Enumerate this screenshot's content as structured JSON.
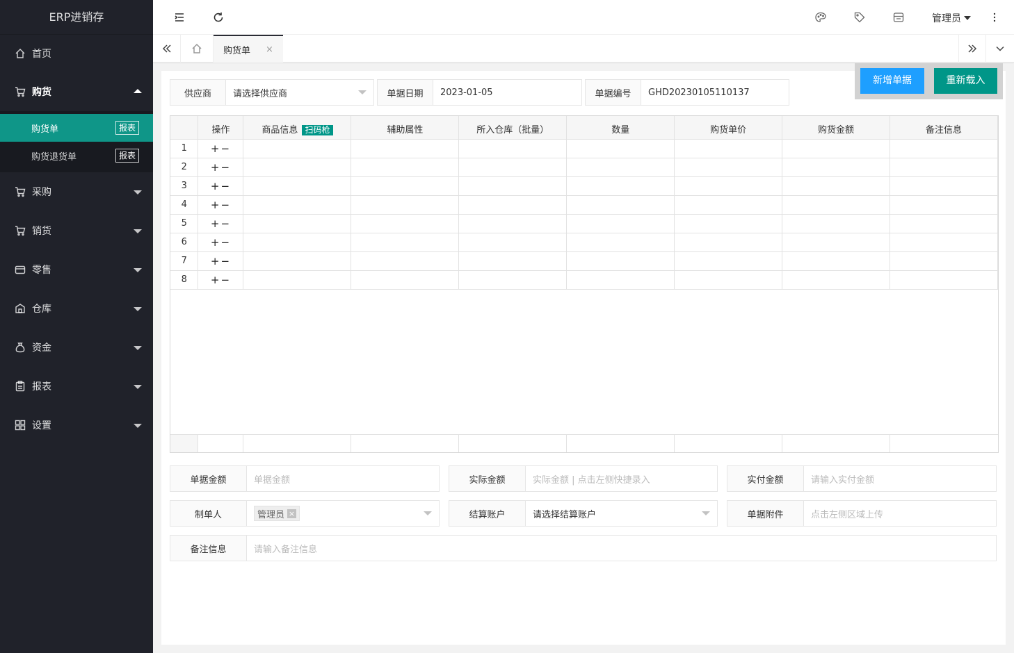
{
  "app": {
    "title": "ERP进销存"
  },
  "sidebar": {
    "home": "首页",
    "purchase_goods": "购货",
    "sub_items": [
      {
        "label": "购货单",
        "tag": "报表"
      },
      {
        "label": "购货退货单",
        "tag": "报表"
      }
    ],
    "procurement": "采购",
    "sales": "销货",
    "retail": "零售",
    "warehouse": "仓库",
    "funds": "资金",
    "reports": "报表",
    "settings": "设置"
  },
  "header": {
    "user": "管理员"
  },
  "tabs": {
    "active": "购货单",
    "close": "×"
  },
  "actions": {
    "new": "新增单据",
    "reload": "重新载入"
  },
  "form": {
    "supplier_label": "供应商",
    "supplier_placeholder": "请选择供应商",
    "date_label": "单据日期",
    "date_value": "2023-01-05",
    "number_label": "单据编号",
    "number_value": "GHD20230105110137"
  },
  "grid": {
    "headers": [
      "操作",
      "商品信息",
      "辅助属性",
      "所入仓库（批量）",
      "数量",
      "购货单价",
      "购货金额",
      "备注信息"
    ],
    "scan_tag": "扫码枪",
    "rows": [
      "1",
      "2",
      "3",
      "4",
      "5",
      "6",
      "7",
      "8"
    ],
    "ops": "+−"
  },
  "bottom": {
    "amount_label": "单据金额",
    "amount_placeholder": "单据金额",
    "actual_label": "实际金额",
    "actual_placeholder": "实际金额 | 点击左侧快捷录入",
    "paid_label": "实付金额",
    "paid_placeholder": "请输入实付金额",
    "maker_label": "制单人",
    "maker_value": "管理员",
    "account_label": "结算账户",
    "account_placeholder": "请选择结算账户",
    "attach_label": "单据附件",
    "attach_placeholder": "点击左侧区域上传",
    "note_label": "备注信息",
    "note_placeholder": "请输入备注信息"
  },
  "colors": {
    "sidebar": "#20222a",
    "accent": "#009688",
    "blue": "#1e9fff"
  }
}
